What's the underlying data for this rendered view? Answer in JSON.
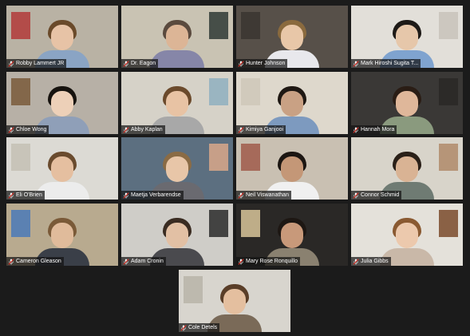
{
  "meeting": {
    "participants": [
      {
        "name": "Robby Lammert JR",
        "muted": true,
        "active": false,
        "wall": "#b9b2a4",
        "shirt": "#8aa4c4",
        "hair": "#6a4a2a",
        "skin": "#e7c3a6",
        "accent": "#b23a3a"
      },
      {
        "name": "Dr. Eagon",
        "muted": true,
        "active": true,
        "wall": "#c9c3b3",
        "shirt": "#8686a8",
        "hair": "#5a4a3e",
        "skin": "#dcb596",
        "accent": "#2f3a35"
      },
      {
        "name": "Hunter Johnson",
        "muted": true,
        "active": false,
        "wall": "#575049",
        "shirt": "#e8e8ec",
        "hair": "#8a6a3e",
        "skin": "#e8c7a8",
        "accent": "#3a3530"
      },
      {
        "name": "Mark Hiroshi Sugita T...",
        "muted": true,
        "active": false,
        "wall": "#e2dfd9",
        "shirt": "#7fa3cf",
        "hair": "#1e1a17",
        "skin": "#e6c7aa",
        "accent": "#c8c3ba"
      },
      {
        "name": "Chloe Wong",
        "muted": true,
        "active": false,
        "wall": "#b7b0a6",
        "shirt": "#8f9fb8",
        "hair": "#17130f",
        "skin": "#edd0b8",
        "accent": "#7a5a3a"
      },
      {
        "name": "Abby Kaplan",
        "muted": true,
        "active": false,
        "wall": "#d6d2c8",
        "shirt": "#a8a8a8",
        "hair": "#6b4a2c",
        "skin": "#e8c3a4",
        "accent": "#8fb0c0"
      },
      {
        "name": "Kimiya Ganjooi",
        "muted": true,
        "active": false,
        "wall": "#ded8cc",
        "shirt": "#7d9abf",
        "hair": "#1f1813",
        "skin": "#c9a184",
        "accent": "#cfc8b8"
      },
      {
        "name": "Hannah Mora",
        "muted": true,
        "active": false,
        "wall": "#3a3836",
        "shirt": "#8a9a7e",
        "hair": "#2a1d15",
        "skin": "#dfb79a",
        "accent": "#2a2826"
      },
      {
        "name": "Eli O'Brien",
        "muted": true,
        "active": false,
        "wall": "#dcdad4",
        "shirt": "#ececec",
        "hair": "#6a4b2e",
        "skin": "#e5bfa0",
        "accent": "#c4bfb4"
      },
      {
        "name": "Maetja Verbarendse",
        "muted": true,
        "active": false,
        "wall": "#5c6f80",
        "shirt": "#6a6a70",
        "hair": "#8a6b45",
        "skin": "#e8c6a8",
        "accent": "#d9a88a"
      },
      {
        "name": "Neil Viswanathan",
        "muted": true,
        "active": false,
        "wall": "#c9c0b2",
        "shirt": "#f0f0f0",
        "hair": "#1c1612",
        "skin": "#c49777",
        "accent": "#a05a4a"
      },
      {
        "name": "Connor Schmid",
        "muted": true,
        "active": false,
        "wall": "#d8d4ca",
        "shirt": "#6f7b73",
        "hair": "#2a2018",
        "skin": "#d9b394",
        "accent": "#b08a6a"
      },
      {
        "name": "Cameron Gleason",
        "muted": true,
        "active": false,
        "wall": "#b8aa8f",
        "shirt": "#3a3f48",
        "hair": "#7a5a38",
        "skin": "#e0bb9b",
        "accent": "#4a7ab8"
      },
      {
        "name": "Adam Cronin",
        "muted": true,
        "active": false,
        "wall": "#cfcdc8",
        "shirt": "#4a4a4e",
        "hair": "#3a2c22",
        "skin": "#e2c0a4",
        "accent": "#2a2a2a"
      },
      {
        "name": "Mary Rose Ronquillo",
        "muted": true,
        "active": false,
        "wall": "#2a2826",
        "shirt": "#8a8170",
        "hair": "#1d1713",
        "skin": "#c8997a",
        "accent": "#d8c49a"
      },
      {
        "name": "Julia Gibbs",
        "muted": true,
        "active": false,
        "wall": "#e4e1da",
        "shirt": "#c9b8a8",
        "hair": "#8a5a32",
        "skin": "#ecc9ad",
        "accent": "#7a4a2a"
      },
      {
        "name": "Cole Detels",
        "muted": true,
        "active": false,
        "wall": "#d8d5ce",
        "shirt": "#7a6a58",
        "hair": "#5a3e28",
        "skin": "#e4bf9f",
        "accent": "#b9b4a8"
      }
    ]
  }
}
